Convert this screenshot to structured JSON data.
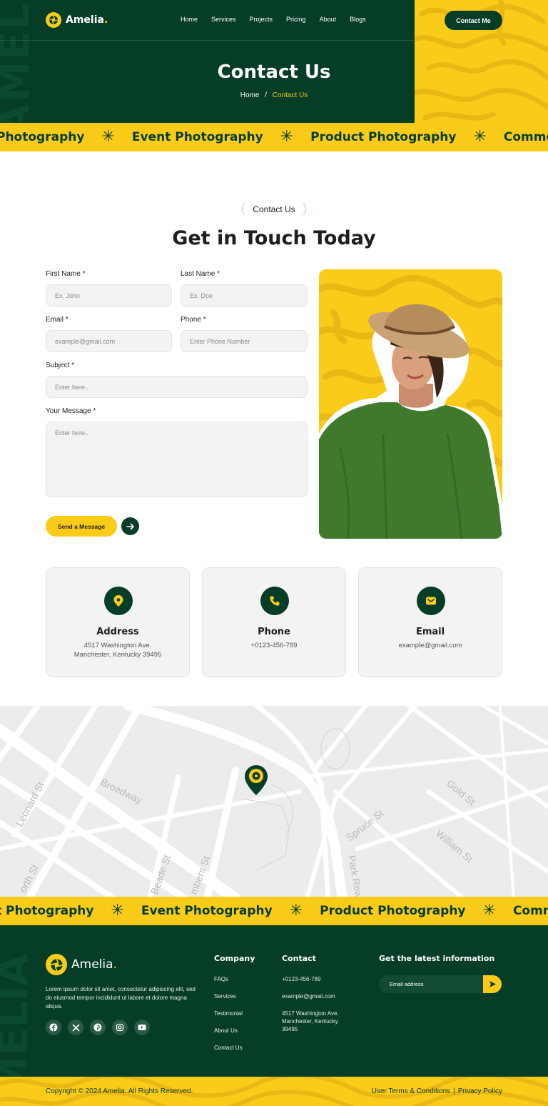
{
  "brand": {
    "name": "Amelia",
    "dot": "."
  },
  "nav": {
    "items": [
      "Home",
      "Services",
      "Projects",
      "Pricing",
      "About",
      "Blogs"
    ],
    "cta": "Contact Me"
  },
  "hero": {
    "title": "Contact Us",
    "crumb_home": "Home",
    "crumb_sep": "/",
    "crumb_current": "Contact Us"
  },
  "marquee": {
    "items": [
      "Photography",
      "Event Photography",
      "Product Photography",
      "Commercial Photography"
    ],
    "separator": "✳"
  },
  "contact": {
    "pill": "Contact Us",
    "title": "Get in Touch Today",
    "first_name_label": "First Name *",
    "first_name_placeholder": "Ex. John",
    "last_name_label": "Last Name *",
    "last_name_placeholder": "Ex. Doe",
    "email_label": "Email *",
    "email_placeholder": "example@gmail.com",
    "phone_label": "Phone *",
    "phone_placeholder": "Enter Phone Number",
    "subject_label": "Subject *",
    "subject_placeholder": "Enter here..",
    "message_label": "Your Message *",
    "message_placeholder": "Enter here..",
    "send_label": "Send a Message"
  },
  "cards": {
    "address_title": "Address",
    "address_line1": "4517 Washington Ave.",
    "address_line2": "Manchester, Kentucky 39495",
    "phone_title": "Phone",
    "phone_value": "+0123-456-789",
    "email_title": "Email",
    "email_value": "example@gmail.com"
  },
  "map": {
    "labels": [
      "Leonard St",
      "Broadway",
      "Spruce St",
      "Gold St",
      "William St",
      "Park Row",
      "Beade St",
      "mbers St",
      "orth St"
    ]
  },
  "footer": {
    "about": "Lorem ipsum dolor sit amet, consectetur adipiscing elit, sed do eiusmod tempor incididunt ut labore et dolore magna aliqua.",
    "company_title": "Company",
    "company_links": [
      "FAQs",
      "Services",
      "Testimonial",
      "About Us",
      "Contact Us"
    ],
    "contact_title": "Contact",
    "contact_phone": "+0123-456-789",
    "contact_email": "example@gmail.com",
    "contact_address": "4517 Washington Ave. Manchester, Kentucky 39495",
    "newsletter_title": "Get the latest information",
    "newsletter_placeholder": "Email address",
    "copyright": "Copyright © 2024 Amelia. All Rights Reserved.",
    "terms": "User Terms & Conditions",
    "legal_sep": "|",
    "privacy": "Privacy Policy",
    "watermark": "AMELIA"
  },
  "colors": {
    "primary": "#063d27",
    "accent": "#fbcb1a",
    "surface": "#f3f3f3"
  }
}
